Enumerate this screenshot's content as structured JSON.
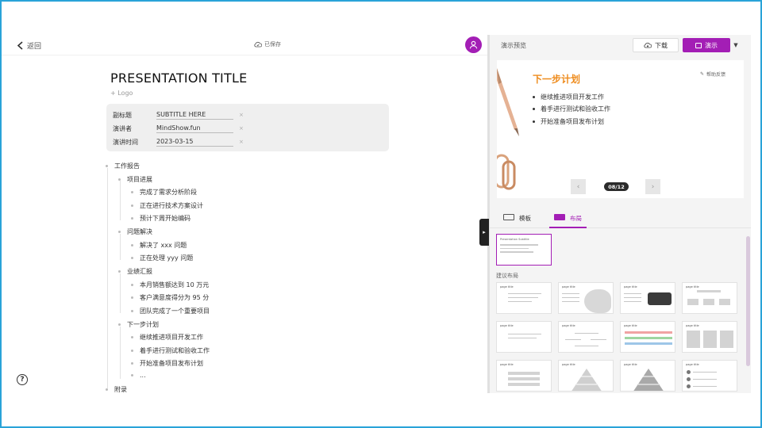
{
  "header": {
    "back_label": "返回",
    "saved_label": "已保存",
    "avatar_icon": "user-icon"
  },
  "doc": {
    "title": "PRESENTATION TITLE",
    "logo_placeholder": "+ Logo",
    "meta": [
      {
        "label": "副标题",
        "value": "SUBTITLE HERE"
      },
      {
        "label": "演讲者",
        "value": "MindShow.fun"
      },
      {
        "label": "演讲时间",
        "value": "2023-03-15"
      }
    ]
  },
  "outline": {
    "root": "工作报告",
    "sections": [
      {
        "title": "项目进展",
        "items": [
          "完成了需求分析阶段",
          "正在进行技术方案设计",
          "预计下周开始编码"
        ]
      },
      {
        "title": "问题解决",
        "items": [
          "解决了 xxx 问题",
          "正在处理 yyy 问题"
        ]
      },
      {
        "title": "业绩汇报",
        "items": [
          "本月销售额达到 10 万元",
          "客户满意度得分为 95 分",
          "团队完成了一个重要项目"
        ]
      },
      {
        "title": "下一步计划",
        "items": [
          "继续推进项目开发工作",
          "着手进行测试和验收工作",
          "开始准备项目发布计划",
          "..."
        ]
      }
    ],
    "appendix": "附录"
  },
  "preview": {
    "heading": "演示预览",
    "download_label": "下载",
    "play_label": "演示",
    "feedback_label": "帮助反馈",
    "slide_title": "下一步计划",
    "slide_bullets": [
      "继续推进项目开发工作",
      "着手进行测试和验收工作",
      "开始准备项目发布计划"
    ],
    "pager": "08/12",
    "accent_color": "#a31eb5",
    "slide_title_color": "#ee8b1c"
  },
  "tabs": [
    {
      "label": "模板",
      "active": false
    },
    {
      "label": "布局",
      "active": true
    }
  ],
  "layouts": {
    "suggested_label": "建议布局",
    "current_thumb_title": "Presentation Subtitle",
    "thumb_title": "page title"
  }
}
